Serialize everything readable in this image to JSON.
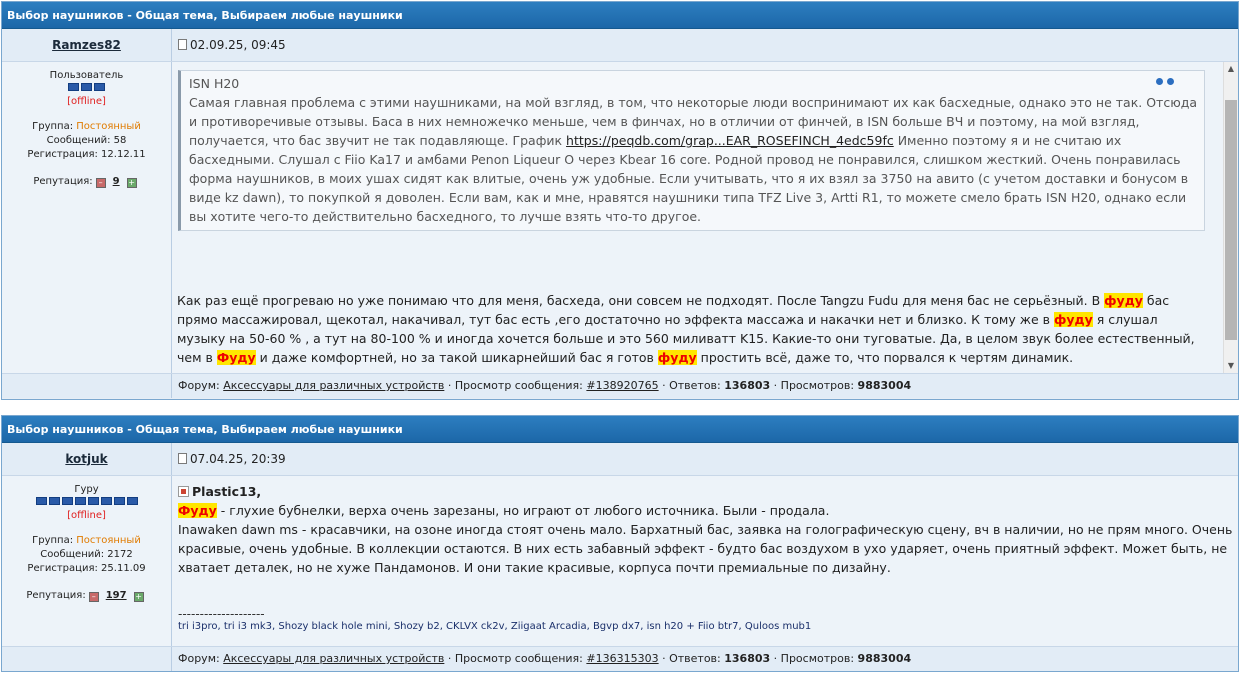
{
  "post1": {
    "topic_title": "Выбор наушников - Общая тема, Выбираем любые наушники",
    "author": "Ramzes82",
    "date": "02.09.25, 09:45",
    "rank": "Пользователь",
    "status": "[offline]",
    "group_label": "Группа:",
    "group_value": "Постоянный",
    "messages_label": "Сообщений:",
    "messages_value": "58",
    "reg_label": "Регистрация:",
    "reg_value": "12.12.11",
    "rep_label": "Репутация:",
    "rep_value": "9",
    "quote": {
      "title": "ISN H20",
      "text1": "Самая главная проблема с этими наушниками, на мой взгляд, в том, что некоторые люди воспринимают их как басхедные, однако это не так. Отсюда и противоречивые отзывы. Баса в них немножечко меньше, чем в финчах, но в отличии от финчей, в ISN больше ВЧ и поэтому, на мой взгляд, получается, что бас звучит не так подавляюще. График ",
      "link": "https://peqdb.com/grap...EAR_ROSEFINCH_4edc59fc",
      "text2": " Именно поэтому я и не считаю их басхедными. Слушал с Fiio Ka17 и амбами Penon Liqueur O через Kbear 16 core. Родной провод не понравился, слишком жесткий. Очень понравилась форма наушников, в моих ушах сидят как влитые, очень уж удобные. Если учитывать, что я их взял за 3750 на авито (с учетом доставки и бонусом в виде kz dawn), то покупкой я доволен. Если вам, как и мне, нравятся наушники типа TFZ Live 3, Artti R1, то можете смело брать ISN H20, однако если вы хотите чего-то действительно басхедного, то лучше взять что-то другое."
    },
    "text": {
      "p1": "Как раз ещё прогреваю но уже понимаю что для меня, басхеда, они совсем не подходят. После Tangzu Fudu для меня бас не серьёзный. В ",
      "hl1": "фуду",
      "p2": " бас прямо массажировал, щекотал, накачивал, тут бас есть ,его достаточно но эффекта массажа и накачки нет и близко. К тому же в ",
      "hl2": "фуду",
      "p3": " я слушал музыку на 50-60 % , а тут на 80-100 % и иногда хочется больше и это 560 миливатт K15. Какие-то они туговатые. Да, в целом звук более естественный, чем в ",
      "hl3": "Фуду",
      "p4": " и даже комфортней, но за такой шикарнейший бас я готов ",
      "hl4": "фуду",
      "p5": " простить всё, даже то, что порвался к чертям динамик."
    },
    "footer": {
      "forum_label": "Форум:",
      "forum_link": "Аксессуары для различных устройств",
      "view_label": " · Просмотр сообщения:",
      "view_link": "#138920765",
      "replies_label": " · Ответов:",
      "replies_value": "136803",
      "views_label": " · Просмотров:",
      "views_value": "9883004"
    }
  },
  "post2": {
    "topic_title": "Выбор наушников - Общая тема, Выбираем любые наушники",
    "author": "kotjuk",
    "date": "07.04.25, 20:39",
    "rank": "Гуру",
    "status": "[offline]",
    "group_label": "Группа:",
    "group_value": "Постоянный",
    "messages_label": "Сообщений:",
    "messages_value": "2172",
    "reg_label": "Регистрация:",
    "reg_value": "25.11.09",
    "rep_label": "Репутация:",
    "rep_value": "197",
    "reply_to": "Plastic13,",
    "text": {
      "hl1": "Фуду",
      "p1": " - глухие бубнелки, верха очень зарезаны, но играют от любого источника. Были - продала.",
      "p2": "Inawaken dawn ms - красавчики, на озоне иногда стоят очень мало. Бархатный бас, заявка на голографическую сцену, вч в наличии, но не прям много. Очень красивые, очень удобные. В коллекции остаются. В них есть забавный эффект - будто бас воздухом в ухо ударяет, очень приятный эффект. Может быть, не хватает деталек, но не хуже Пандамонов. И они такие красивые, корпуса почти премиальные по дизайну."
    },
    "signature_sep": "--------------------",
    "signature": "tri i3pro, tri i3 mk3, Shozy black hole mini, Shozy b2, CKLVX ck2v, Ziigaat Arcadia, Bgvp dx7, isn h20 + Fiio btr7, Quloos mub1",
    "footer": {
      "forum_label": "Форум:",
      "forum_link": "Аксессуары для различных устройств",
      "view_label": " · Просмотр сообщения:",
      "view_link": "#136315303",
      "replies_label": " · Ответов:",
      "replies_value": "136803",
      "views_label": " · Просмотров:",
      "views_value": "9883004"
    }
  },
  "colors": {
    "header_blue": "#1c67a8",
    "highlight_bg": "#ffe600",
    "highlight_text": "#e00000",
    "offline": "#e02020",
    "group": "#e07b00"
  }
}
